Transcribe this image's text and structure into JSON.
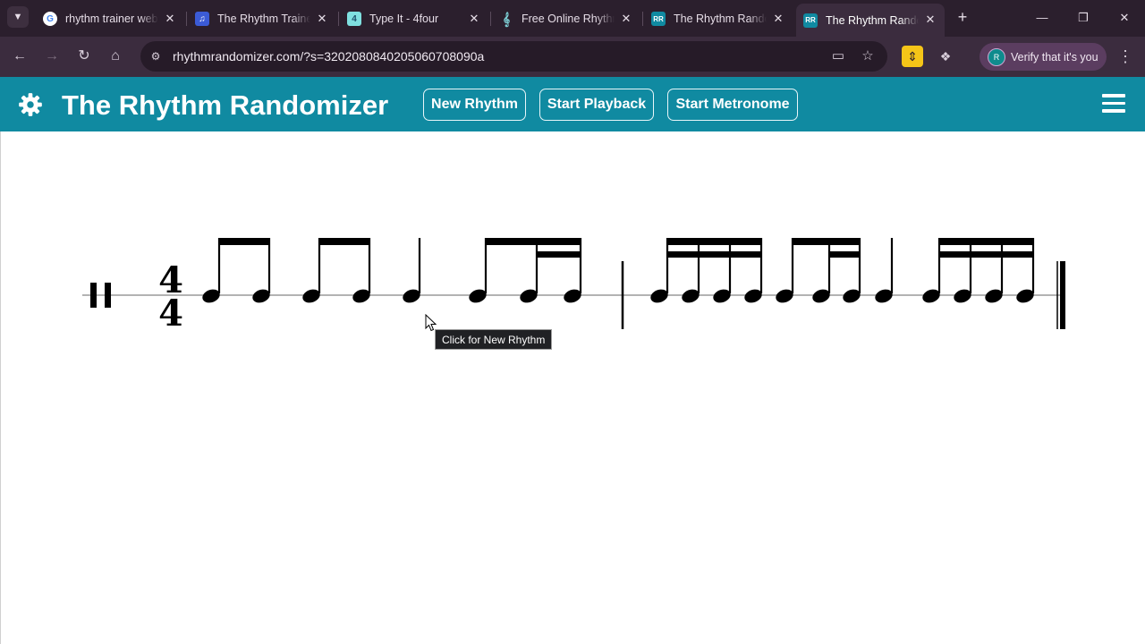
{
  "browser": {
    "tabs": [
      {
        "title": "rhythm trainer web",
        "favicon": "google-icon",
        "active": false
      },
      {
        "title": "The Rhythm Trainer",
        "favicon": "music-note-icon",
        "active": false
      },
      {
        "title": "Type It - 4four",
        "favicon": "4four-icon",
        "active": false
      },
      {
        "title": "Free Online Rhythm",
        "favicon": "treble-clef-icon",
        "active": false
      },
      {
        "title": "The Rhythm Randomizer",
        "favicon": "rhythm-randomizer-icon",
        "active": false
      },
      {
        "title": "The Rhythm Randomizer",
        "favicon": "rhythm-randomizer-icon",
        "active": true
      }
    ],
    "url": "rhythmrandomizer.com/?s=3202080840205060708090a",
    "profile_button": "Verify that it's you",
    "profile_initial": "R"
  },
  "app": {
    "title": "The Rhythm Randomizer",
    "buttons": {
      "new_rhythm": "New Rhythm",
      "start_playback": "Start Playback",
      "start_metronome": "Start Metronome"
    },
    "colors": {
      "app_bar": "#108aa1",
      "browser_frame": "#2b1f2d"
    }
  },
  "score": {
    "clef": "percussion",
    "time_signature": {
      "top": "4",
      "bottom": "4"
    },
    "measures": [
      {
        "beats": [
          "eighth-eighth",
          "eighth-eighth",
          "quarter",
          "eighth-sixteenth-sixteenth"
        ]
      },
      {
        "beats": [
          "four-sixteenths",
          "eighth-sixteenth-sixteenth",
          "quarter",
          "four-sixteenths"
        ]
      }
    ],
    "end_barline": "final"
  },
  "tooltip": "Click for New Rhythm"
}
